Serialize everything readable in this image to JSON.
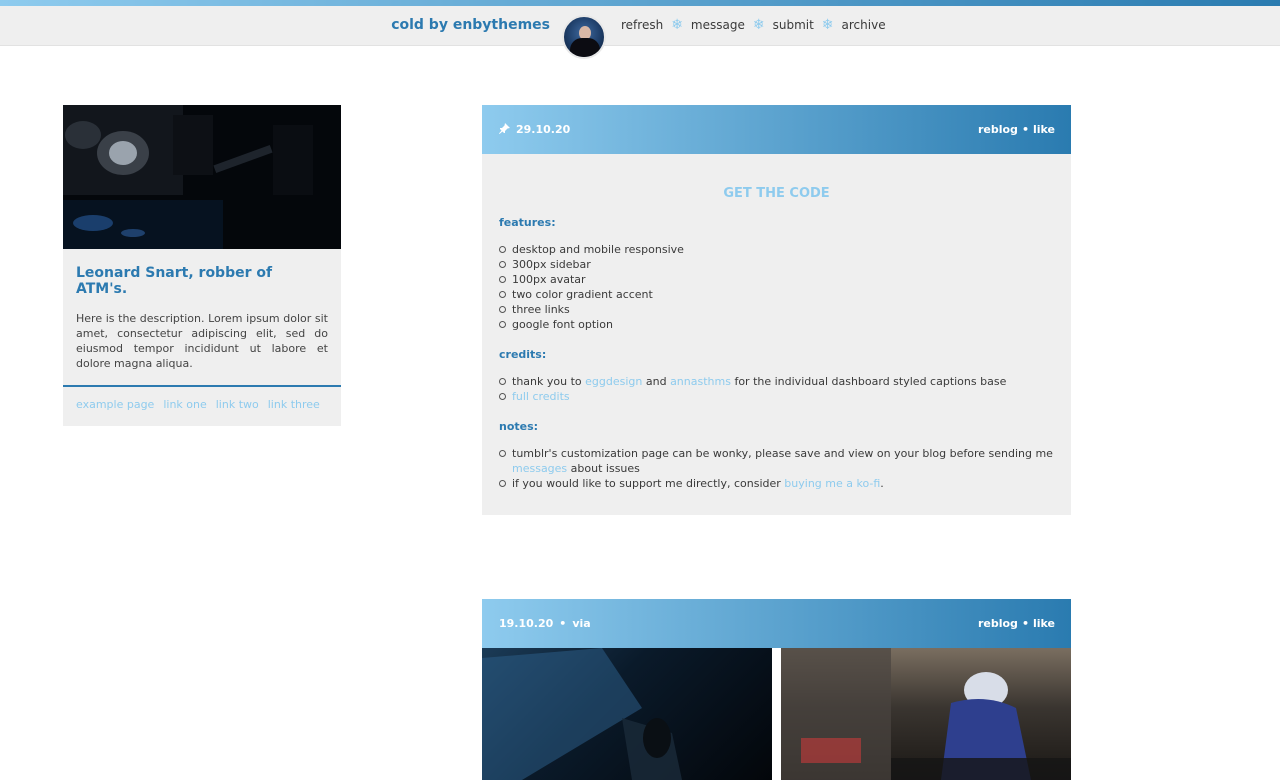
{
  "header": {
    "title": "cold by enbythemes",
    "nav": [
      {
        "label": "refresh"
      },
      {
        "label": "message"
      },
      {
        "label": "submit"
      },
      {
        "label": "archive"
      }
    ],
    "separator_glyph": "❄",
    "colors": {
      "accent_light": "#8ecbee",
      "accent_dark": "#2a7bb0"
    }
  },
  "sidebar": {
    "title": "Leonard Snart, robber of ATM's.",
    "description": "Here is the description. Lorem ipsum dolor sit amet, consectetur adipiscing elit, sed do eiusmod tempor incididunt ut labore et dolore magna aliqua.",
    "links": [
      {
        "label": "example page"
      },
      {
        "label": "link one"
      },
      {
        "label": "link two"
      },
      {
        "label": "link three"
      }
    ]
  },
  "post1": {
    "date": "29.10.20",
    "pin_icon": "pin-icon",
    "reblog": "reblog",
    "separator": "•",
    "like": "like",
    "get_code": "GET THE CODE",
    "features_heading": "features:",
    "features": [
      "desktop and mobile responsive",
      "300px sidebar",
      "100px avatar",
      "two color gradient accent",
      "three links",
      "google font option"
    ],
    "credits_heading": "credits:",
    "credits": {
      "thank_prefix": "thank you to ",
      "link1": "eggdesign",
      "and": " and ",
      "link2": "annasthms",
      "thank_suffix": " for the  individual dashboard styled captions base",
      "full_credits": "full credits"
    },
    "notes_heading": "notes:",
    "notes": {
      "note1_prefix": "tumblr's customization page can be wonky, please save and view on your blog before sending me ",
      "note1_link": "messages",
      "note1_suffix": " about issues",
      "note2_prefix": "if you would like to support me directly, consider ",
      "note2_link": "buying me a ko-fi",
      "note2_suffix": "."
    }
  },
  "post2": {
    "date": "19.10.20",
    "separator": "•",
    "via": "via",
    "reblog": "reblog",
    "like": "like"
  }
}
